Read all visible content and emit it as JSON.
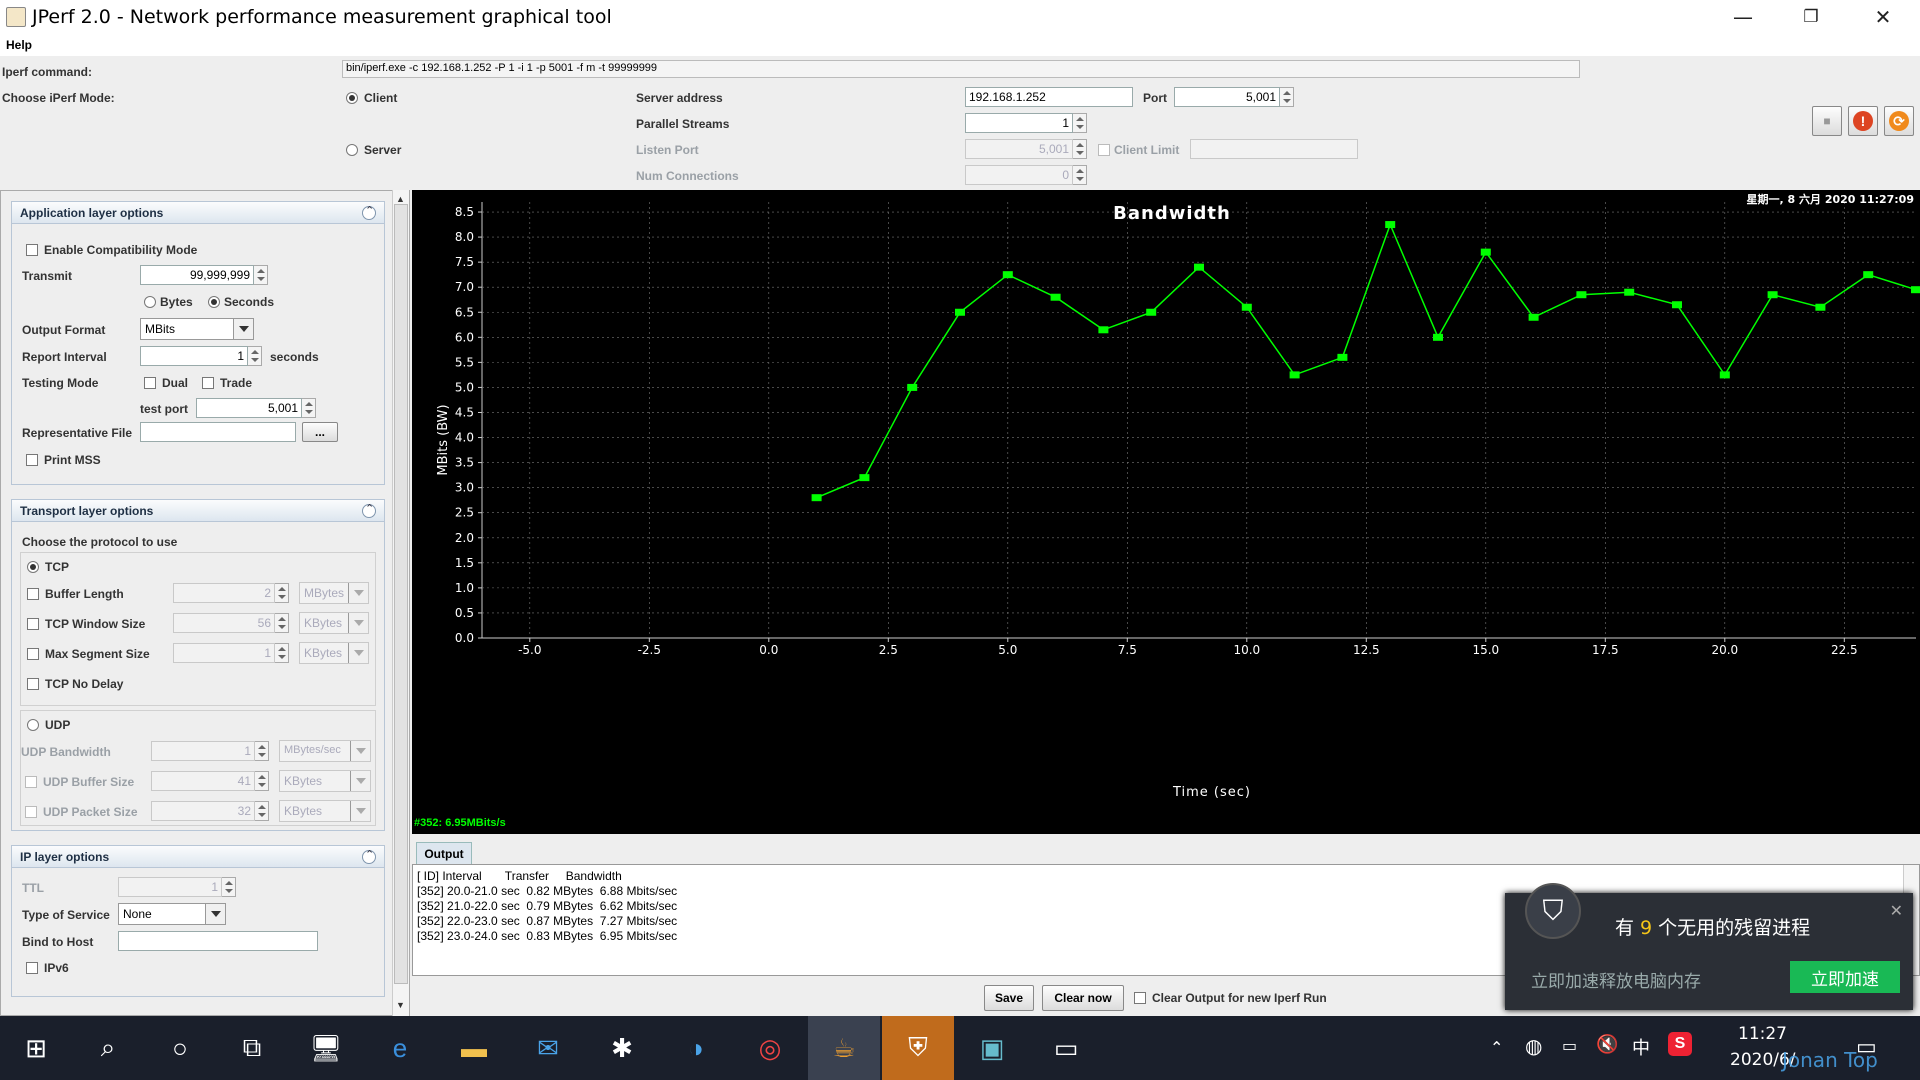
{
  "window": {
    "title": "JPerf 2.0 - Network performance measurement graphical tool",
    "min": "—",
    "max": "❐",
    "close": "✕"
  },
  "menu": {
    "help": "Help"
  },
  "top": {
    "iperf_command_label": "Iperf command:",
    "iperf_command": "bin/iperf.exe -c 192.168.1.252 -P 1 -i 1 -p 5001 -f m -t 99999999",
    "mode_label": "Choose iPerf Mode:",
    "client": "Client",
    "server": "Server",
    "server_address_label": "Server address",
    "server_address": "192.168.1.252",
    "port_label": "Port",
    "port": "5,001",
    "parallel_label": "Parallel Streams",
    "parallel": "1",
    "listen_port_label": "Listen Port",
    "listen_port": "5,001",
    "client_limit_label": "Client Limit",
    "num_conn_label": "Num Connections",
    "num_conn": "0"
  },
  "app_layer": {
    "title": "Application layer options",
    "compat": "Enable Compatibility Mode",
    "transmit_label": "Transmit",
    "transmit": "99,999,999",
    "bytes": "Bytes",
    "seconds": "Seconds",
    "output_format_label": "Output Format",
    "output_format": "MBits",
    "report_interval_label": "Report Interval",
    "report_interval": "1",
    "seconds_unit": "seconds",
    "testing_mode_label": "Testing Mode",
    "dual": "Dual",
    "trade": "Trade",
    "test_port_label": "test port",
    "test_port": "5,001",
    "rep_file_label": "Representative File",
    "browse": "...",
    "print_mss": "Print MSS"
  },
  "transport": {
    "title": "Transport layer options",
    "choose": "Choose the protocol to use",
    "tcp": "TCP",
    "buffer_length": "Buffer Length",
    "buffer_length_val": "2",
    "buffer_length_unit": "MBytes",
    "tcp_window": "TCP Window Size",
    "tcp_window_val": "56",
    "tcp_window_unit": "KBytes",
    "max_seg": "Max Segment Size",
    "max_seg_val": "1",
    "max_seg_unit": "KBytes",
    "no_delay": "TCP No Delay",
    "udp": "UDP",
    "udp_bw": "UDP Bandwidth",
    "udp_bw_val": "1",
    "udp_bw_unit": "MBytes/sec",
    "udp_buf": "UDP Buffer Size",
    "udp_buf_val": "41",
    "udp_buf_unit": "KBytes",
    "udp_pkt": "UDP Packet Size",
    "udp_pkt_val": "32",
    "udp_pkt_unit": "KBytes"
  },
  "ip_layer": {
    "title": "IP layer options",
    "ttl": "TTL",
    "ttl_val": "1",
    "tos": "Type of Service",
    "tos_val": "None",
    "bind": "Bind to Host",
    "ipv6": "IPv6"
  },
  "chart_data": {
    "type": "line",
    "title": "Bandwidth",
    "xlabel": "Time (sec)",
    "ylabel": "MBits (BW)",
    "timestamp": "星期一, 8 六月 2020 11:27:09",
    "status": "#352: 6.95MBits/s",
    "xlim": [
      -6.0,
      24.0
    ],
    "ylim": [
      0.0,
      8.7
    ],
    "xticks": [
      "-5.0",
      "-2.5",
      "0.0",
      "2.5",
      "5.0",
      "7.5",
      "10.0",
      "12.5",
      "15.0",
      "17.5",
      "20.0",
      "22.5"
    ],
    "yticks": [
      "0.0",
      "0.5",
      "1.0",
      "1.5",
      "2.0",
      "2.5",
      "3.0",
      "3.5",
      "4.0",
      "4.5",
      "5.0",
      "5.5",
      "6.0",
      "6.5",
      "7.0",
      "7.5",
      "8.0",
      "8.5"
    ],
    "x": [
      1,
      2,
      3,
      4,
      5,
      6,
      7,
      8,
      9,
      10,
      11,
      12,
      13,
      14,
      15,
      16,
      17,
      18,
      19,
      20,
      21,
      22,
      23,
      24
    ],
    "values": [
      2.8,
      3.2,
      5.0,
      6.5,
      7.25,
      6.8,
      6.15,
      6.5,
      7.4,
      6.6,
      5.25,
      5.6,
      8.25,
      6.0,
      7.7,
      6.4,
      6.85,
      6.9,
      6.65,
      5.25,
      6.85,
      6.6,
      7.25,
      6.95
    ],
    "line_color": "#00ff00",
    "grid": true
  },
  "output": {
    "tab": "Output",
    "lines": [
      "[ ID] Interval       Transfer     Bandwidth",
      "[352] 20.0-21.0 sec  0.82 MBytes  6.88 Mbits/sec",
      "[352] 21.0-22.0 sec  0.79 MBytes  6.62 Mbits/sec",
      "[352] 22.0-23.0 sec  0.87 MBytes  7.27 Mbits/sec",
      "[352] 23.0-24.0 sec  0.83 MBytes  6.95 Mbits/sec"
    ],
    "save": "Save",
    "clear": "Clear now",
    "clear_check": "Clear Output for new Iperf Run"
  },
  "popup": {
    "text_a": "有 ",
    "count": "9",
    "text_b": " 个无用的残留进程",
    "sub": "立即加速释放电脑内存",
    "action": "立即加速",
    "close": "✕"
  },
  "taskbar": {
    "time": "11:27",
    "date": "2020/6/",
    "ime": "中",
    "watermark": "Jonan Top"
  }
}
